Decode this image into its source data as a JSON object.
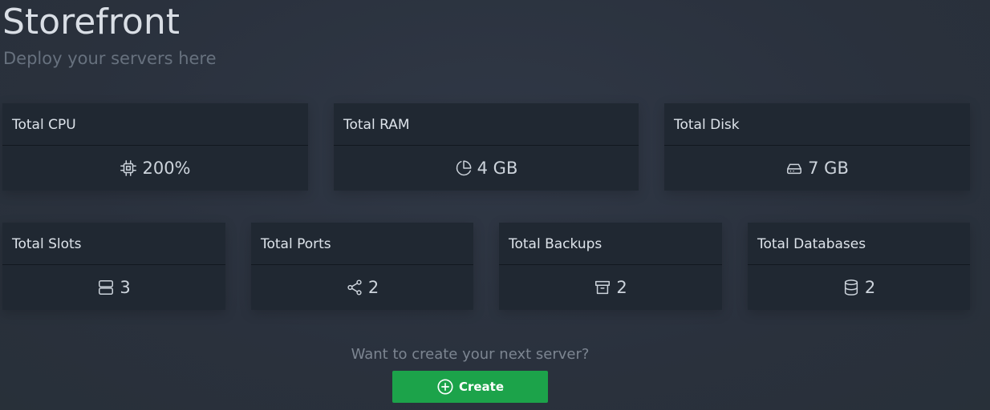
{
  "header": {
    "title": "Storefront",
    "subtitle": "Deploy your servers here"
  },
  "stats_row1": [
    {
      "label": "Total CPU",
      "value": "200%",
      "icon": "cpu-icon"
    },
    {
      "label": "Total RAM",
      "value": "4 GB",
      "icon": "pie-chart-icon"
    },
    {
      "label": "Total Disk",
      "value": "7 GB",
      "icon": "hard-drive-icon"
    }
  ],
  "stats_row2": [
    {
      "label": "Total Slots",
      "value": "3",
      "icon": "server-icon"
    },
    {
      "label": "Total Ports",
      "value": "2",
      "icon": "share-icon"
    },
    {
      "label": "Total Backups",
      "value": "2",
      "icon": "archive-icon"
    },
    {
      "label": "Total Databases",
      "value": "2",
      "icon": "database-icon"
    }
  ],
  "cta": {
    "prompt": "Want to create your next server?",
    "button_label": "Create",
    "button_icon": "plus-circle-icon",
    "button_color": "#1ca34a"
  }
}
